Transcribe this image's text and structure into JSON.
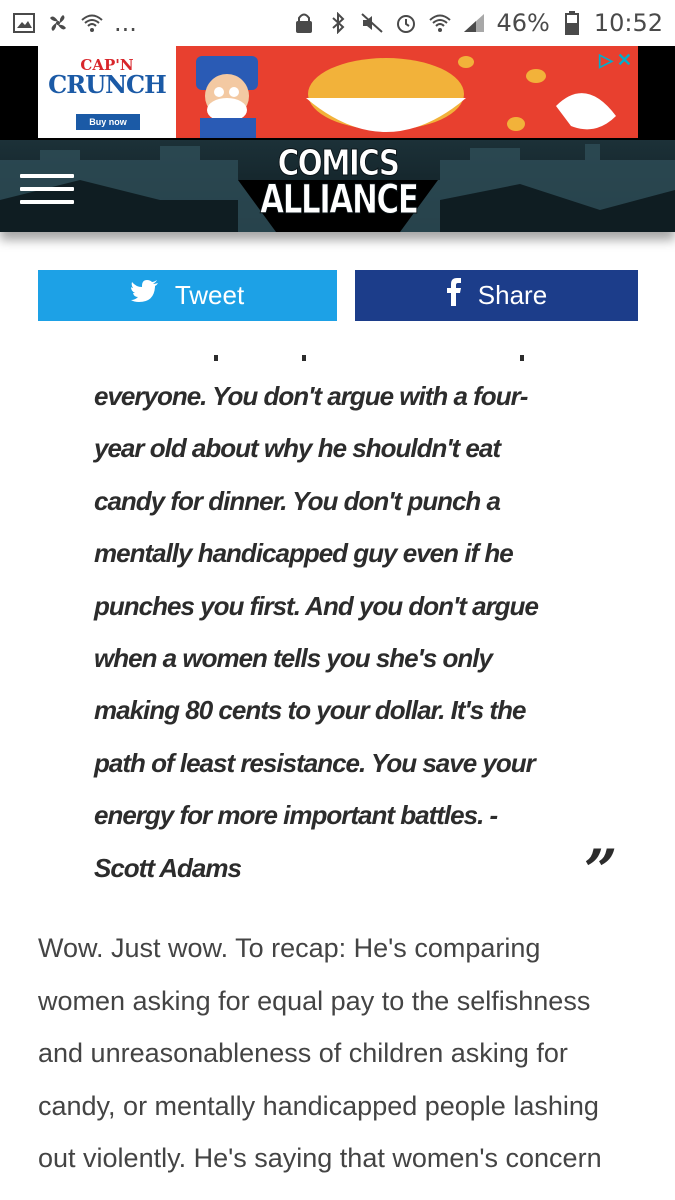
{
  "status_bar": {
    "battery": "46%",
    "time": "10:52",
    "dots": "..."
  },
  "ad": {
    "brand_line1": "CAP'N",
    "brand_line2": "CRUNCH",
    "cta": "Buy now",
    "accent": "#e8402f"
  },
  "header": {
    "logo_line1": "COMICS",
    "logo_line2": "ALLIANCE"
  },
  "share": {
    "tweet_label": "Tweet",
    "share_label": "Share",
    "tweet_color": "#1da1e6",
    "share_color": "#1c3d8a"
  },
  "quote": {
    "lines": [
      "everyone. You don't argue with a four-",
      "year old about why he shouldn't eat",
      "candy for dinner. You don't punch a",
      "mentally handicapped guy even if he",
      "punches you first. And you don't argue",
      "when a women tells you she's only",
      "making 80 cents to your dollar. It's the",
      "path of least resistance. You save your",
      "energy for more important battles. -",
      "Scott Adams"
    ],
    "close_mark": "”"
  },
  "article": {
    "lines": [
      "Wow. Just wow. To recap: He's comparing",
      "women asking for equal pay to the selfishness",
      "and unreasonableness of children asking for",
      "candy, or mentally handicapped people lashing",
      "out violently. He's saying that women's concern"
    ]
  }
}
